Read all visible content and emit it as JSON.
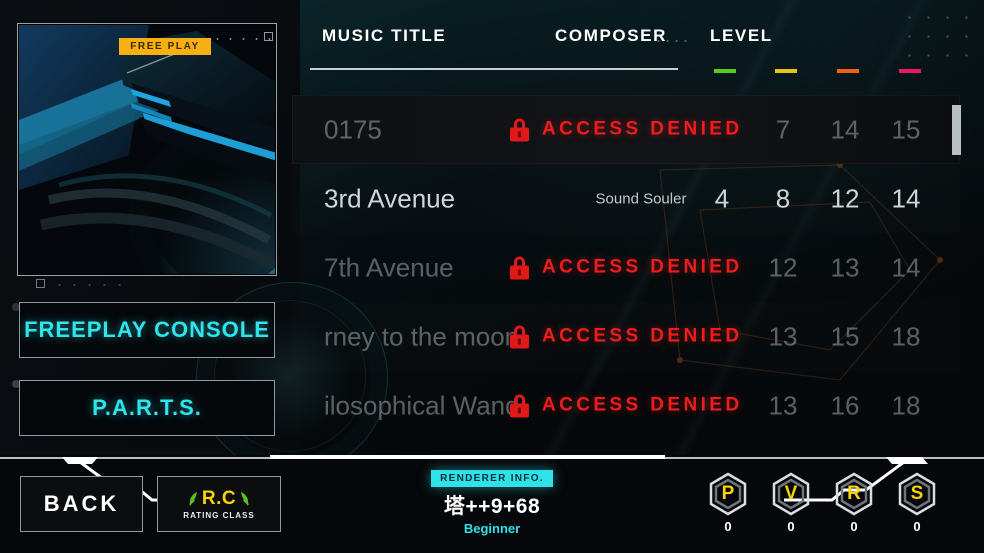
{
  "jacket": {
    "badge_label": "FREE PLAY",
    "art_name": "album-jacket-art"
  },
  "left_menu": {
    "buttons": [
      {
        "label": "FREEPLAY CONSOLE",
        "name": "freeplay-console-button"
      },
      {
        "label": "P.A.R.T.S.",
        "name": "parts-button"
      }
    ]
  },
  "list_header": {
    "music_title": "MUSIC TITLE",
    "composer": "COMPOSER",
    "level": "LEVEL",
    "difficulty_colors": [
      "#5bc924",
      "#e8c215",
      "#ef6012",
      "#ec1566"
    ]
  },
  "denied_label": "ACCESS DENIED",
  "rows": [
    {
      "name": "0175",
      "composer": "",
      "levels": [
        "",
        "7",
        "14",
        "15"
      ],
      "locked": true,
      "selected": true
    },
    {
      "name": "3rd Avenue",
      "composer": "Sound Souler",
      "levels": [
        "4",
        "8",
        "12",
        "14"
      ],
      "locked": false,
      "selected": false
    },
    {
      "name": "7th Avenue",
      "composer": "",
      "levels": [
        "",
        "12",
        "13",
        "14"
      ],
      "locked": true,
      "selected": false
    },
    {
      "name": "rney to the moon",
      "composer": "",
      "levels": [
        "",
        "13",
        "15",
        "18"
      ],
      "locked": true,
      "selected": false
    },
    {
      "name": "ilosophical Wand",
      "composer": "",
      "levels": [
        "",
        "13",
        "16",
        "18"
      ],
      "locked": true,
      "selected": false
    }
  ],
  "bottom": {
    "back_label": "BACK",
    "rating_class": {
      "main": "R.C",
      "sub": "RATING CLASS"
    },
    "renderer": {
      "tag": "RENDERER INFO.",
      "value": "塔++9+68",
      "level": "Beginner"
    },
    "stats": [
      {
        "letter": "P",
        "value": "0",
        "name": "stat-p"
      },
      {
        "letter": "V",
        "value": "0",
        "name": "stat-v"
      },
      {
        "letter": "R",
        "value": "0",
        "name": "stat-r"
      },
      {
        "letter": "S",
        "value": "0",
        "name": "stat-s"
      }
    ]
  },
  "colors": {
    "accent_cyan": "#2fe2ea",
    "accent_gold": "#f7d308",
    "denied_red": "#ee1c1c",
    "freeplay_amber": "#f5b013"
  }
}
